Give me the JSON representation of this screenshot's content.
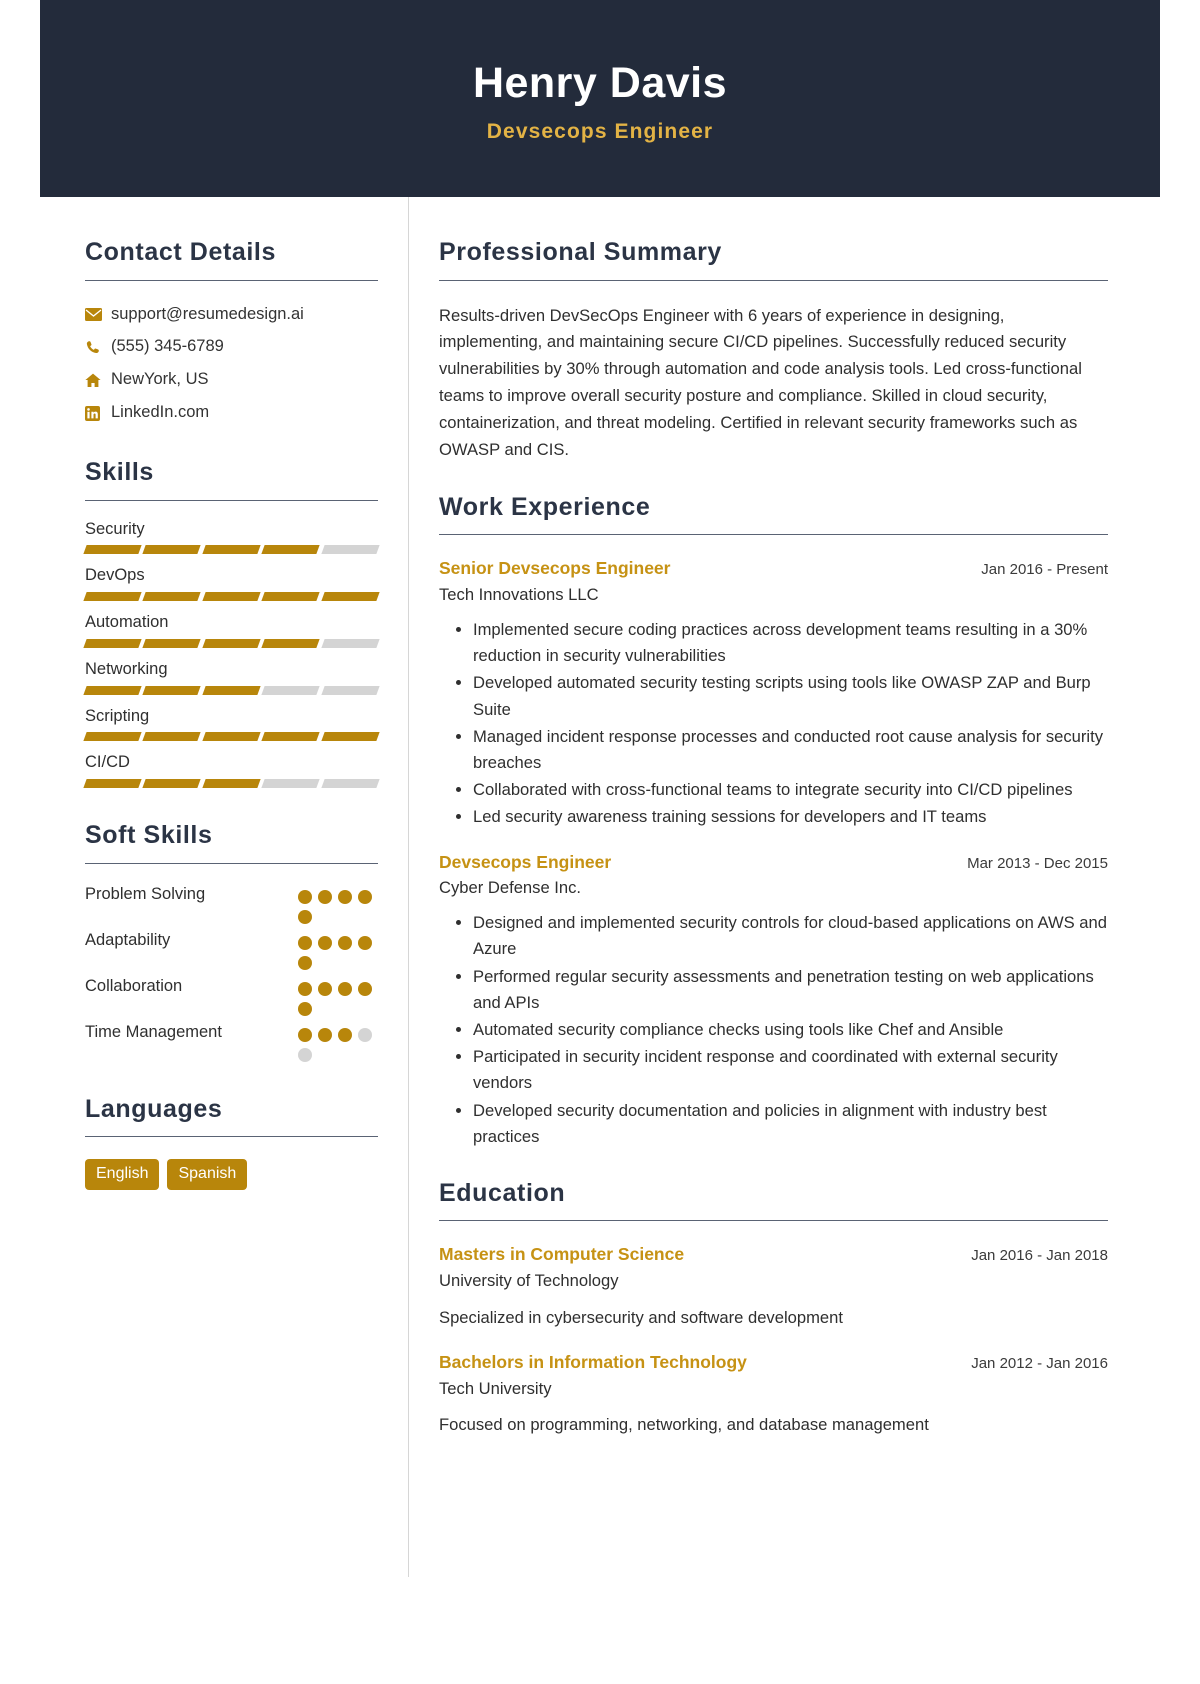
{
  "colors": {
    "header_bg": "#232b3b",
    "accent_gold": "#b8860b",
    "accent_gold_light": "#e3b345",
    "heading_navy": "#2b3445",
    "muted_gray": "#d4d4d4"
  },
  "header": {
    "name": "Henry Davis",
    "title": "Devsecops Engineer"
  },
  "sidebar": {
    "contact": {
      "heading": "Contact Details",
      "items": [
        {
          "icon": "envelope-icon",
          "value": "support@resumedesign.ai"
        },
        {
          "icon": "phone-icon",
          "value": "(555) 345-6789"
        },
        {
          "icon": "home-icon",
          "value": "NewYork, US"
        },
        {
          "icon": "linkedin-icon",
          "value": "LinkedIn.com"
        }
      ]
    },
    "skills": {
      "heading": "Skills",
      "max": 5,
      "items": [
        {
          "name": "Security",
          "level": 4
        },
        {
          "name": "DevOps",
          "level": 5
        },
        {
          "name": "Automation",
          "level": 4
        },
        {
          "name": "Networking",
          "level": 3
        },
        {
          "name": "Scripting",
          "level": 5
        },
        {
          "name": "CI/CD",
          "level": 3
        }
      ]
    },
    "soft_skills": {
      "heading": "Soft Skills",
      "max": 5,
      "items": [
        {
          "name": "Problem Solving",
          "level": 5
        },
        {
          "name": "Adaptability",
          "level": 5
        },
        {
          "name": "Collaboration",
          "level": 5
        },
        {
          "name": "Time Management",
          "level": 3
        }
      ]
    },
    "languages": {
      "heading": "Languages",
      "items": [
        "English",
        "Spanish"
      ]
    }
  },
  "main": {
    "summary": {
      "heading": "Professional Summary",
      "text": "Results-driven DevSecOps Engineer with 6 years of experience in designing, implementing, and maintaining secure CI/CD pipelines. Successfully reduced security vulnerabilities by 30% through automation and code analysis tools. Led cross-functional teams to improve overall security posture and compliance. Skilled in cloud security, containerization, and threat modeling. Certified in relevant security frameworks such as OWASP and CIS."
    },
    "experience": {
      "heading": "Work Experience",
      "entries": [
        {
          "role": "Senior Devsecops Engineer",
          "date": "Jan 2016 - Present",
          "org": "Tech Innovations LLC",
          "bullets": [
            "Implemented secure coding practices across development teams resulting in a 30% reduction in security vulnerabilities",
            "Developed automated security testing scripts using tools like OWASP ZAP and Burp Suite",
            "Managed incident response processes and conducted root cause analysis for security breaches",
            "Collaborated with cross-functional teams to integrate security into CI/CD pipelines",
            "Led security awareness training sessions for developers and IT teams"
          ]
        },
        {
          "role": "Devsecops Engineer",
          "date": "Mar 2013 - Dec 2015",
          "org": "Cyber Defense Inc.",
          "bullets": [
            "Designed and implemented security controls for cloud-based applications on AWS and Azure",
            "Performed regular security assessments and penetration testing on web applications and APIs",
            "Automated security compliance checks using tools like Chef and Ansible",
            "Participated in security incident response and coordinated with external security vendors",
            "Developed security documentation and policies in alignment with industry best practices"
          ]
        }
      ]
    },
    "education": {
      "heading": "Education",
      "entries": [
        {
          "degree": "Masters in Computer Science",
          "date": "Jan 2016 - Jan 2018",
          "school": "University of Technology",
          "description": "Specialized in cybersecurity and software development"
        },
        {
          "degree": "Bachelors in Information Technology",
          "date": "Jan 2012 - Jan 2016",
          "school": "Tech University",
          "description": "Focused on programming, networking, and database management"
        }
      ]
    }
  }
}
